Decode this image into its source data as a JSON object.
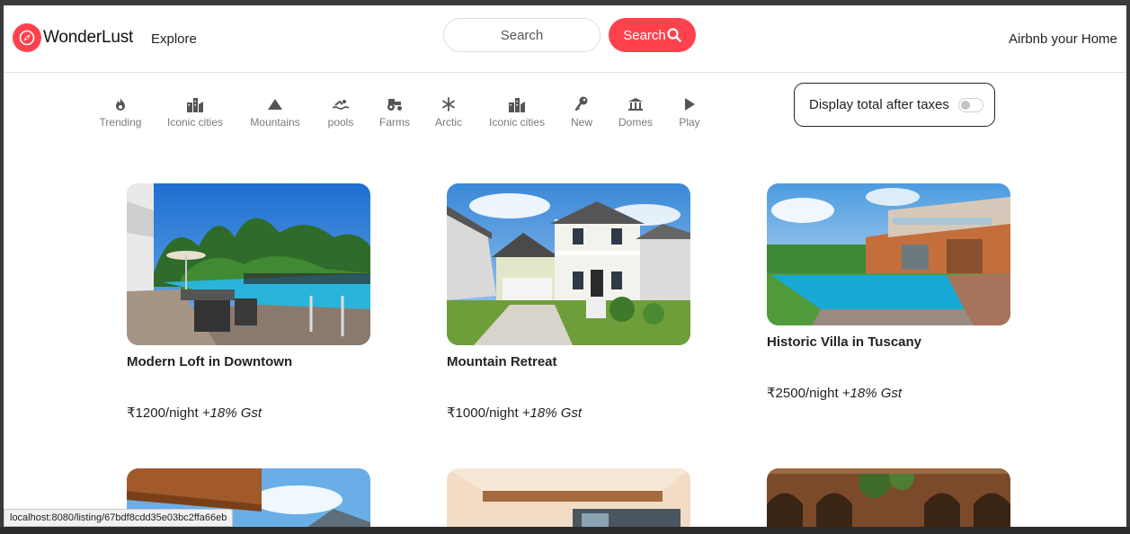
{
  "navbar": {
    "brand_name": "WonderLust",
    "explore_label": "Explore",
    "search_placeholder": "Search",
    "search_button_label": "Search",
    "host_label": "Airbnb your Home",
    "accent_color": "#fe424d"
  },
  "filters": [
    {
      "label": "Trending",
      "icon": "flame-icon"
    },
    {
      "label": "Iconic cities",
      "icon": "city-icon"
    },
    {
      "label": "Mountains",
      "icon": "mountain-icon"
    },
    {
      "label": "pools",
      "icon": "swimmer-icon"
    },
    {
      "label": "Farms",
      "icon": "tractor-icon"
    },
    {
      "label": "Arctic",
      "icon": "snowflake-icon"
    },
    {
      "label": "Iconic cities",
      "icon": "city-icon"
    },
    {
      "label": "New",
      "icon": "key-icon"
    },
    {
      "label": "Domes",
      "icon": "dome-icon"
    },
    {
      "label": "Play",
      "icon": "play-icon"
    }
  ],
  "tax_toggle": {
    "label": "Display total after taxes",
    "enabled": false
  },
  "listings": [
    {
      "title": "Modern Loft in Downtown",
      "price": "₹1200/night",
      "gst": " +18% Gst"
    },
    {
      "title": "Mountain Retreat",
      "price": "₹1000/night",
      "gst": " +18% Gst"
    },
    {
      "title": "Historic Villa in Tuscany",
      "price": "₹2500/night",
      "gst": " +18% Gst"
    }
  ],
  "status_bar": {
    "url": "localhost:8080/listing/67bdf8cdd35e03bc2ffa66eb"
  }
}
